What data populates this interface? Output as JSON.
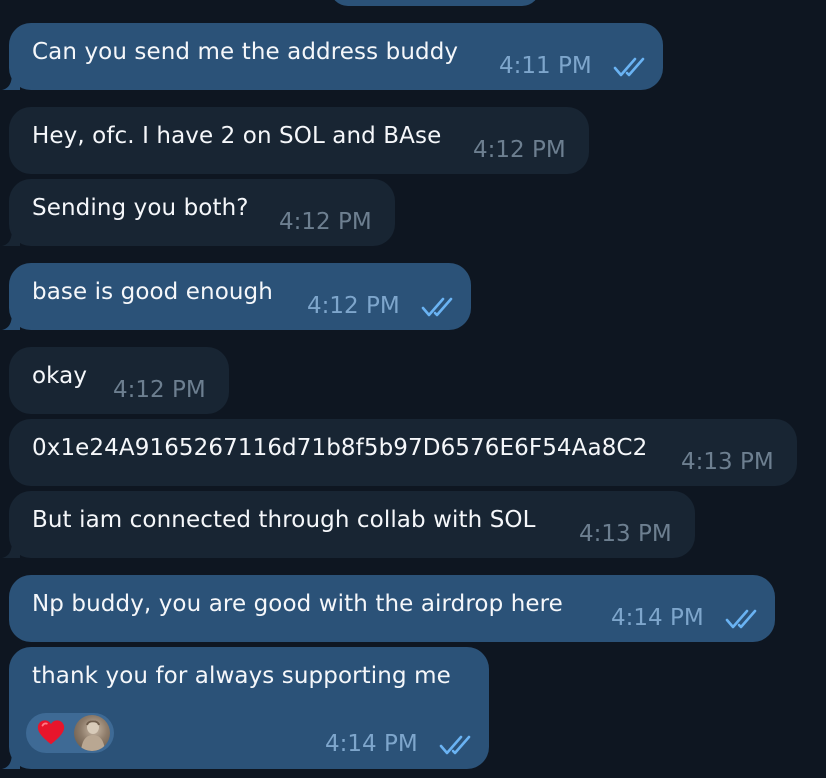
{
  "messages": [
    {
      "text": "Can you send me the address buddy",
      "time": "4:11 PM",
      "direction": "out",
      "read": true
    },
    {
      "text": "Hey, ofc. I have 2 on SOL and BAse",
      "time": "4:12 PM",
      "direction": "in"
    },
    {
      "text": "Sending you both?",
      "time": "4:12 PM",
      "direction": "in"
    },
    {
      "text": "base is good enough",
      "time": "4:12 PM",
      "direction": "out",
      "read": true
    },
    {
      "text": "okay",
      "time": "4:12 PM",
      "direction": "in"
    },
    {
      "text": "0x1e24A9165267116d71b8f5b97D6576E6F54Aa8C2",
      "time": "4:13 PM",
      "direction": "in"
    },
    {
      "text": "But iam connected through collab with SOL",
      "time": "4:13 PM",
      "direction": "in"
    },
    {
      "text": "Np buddy, you are good with the airdrop here",
      "time": "4:14 PM",
      "direction": "out",
      "read": true
    },
    {
      "text": "thank you for always supporting me",
      "time": "4:14 PM",
      "direction": "out",
      "read": true,
      "reactions": [
        "heart-emoji",
        "user-avatar"
      ]
    }
  ],
  "colors": {
    "background": "#0e1621",
    "outgoing_bubble": "#2b5278",
    "incoming_bubble": "#182533",
    "read_ticks": "#6ab3f3"
  }
}
